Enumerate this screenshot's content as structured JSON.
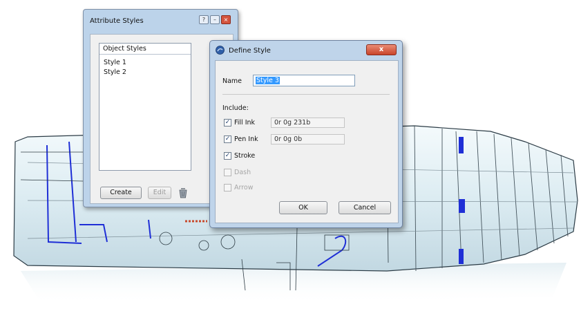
{
  "attribute_styles_window": {
    "title": "Attribute Styles",
    "list_header": "Object Styles",
    "items": [
      "Style 1",
      "Style 2"
    ],
    "create_label": "Create",
    "edit_label": "Edit"
  },
  "define_style_dialog": {
    "title": "Define Style",
    "close_glyph": "x",
    "name_label": "Name",
    "name_value": "Style 3",
    "include_label": "Include:",
    "options": [
      {
        "label": "Fill Ink",
        "checked": true,
        "enabled": true,
        "value": "0r 0g 231b"
      },
      {
        "label": "Pen Ink",
        "checked": true,
        "enabled": true,
        "value": "0r 0g 0b"
      },
      {
        "label": "Stroke",
        "checked": true,
        "enabled": true
      },
      {
        "label": "Dash",
        "checked": false,
        "enabled": false
      },
      {
        "label": "Arrow",
        "checked": false,
        "enabled": false
      }
    ],
    "ok_label": "OK",
    "cancel_label": "Cancel"
  },
  "colors": {
    "window_frame": "#bfd4ea",
    "selection": "#3399ff",
    "model_highlight": "#1f2fd6",
    "model_fill": "#dfeff4"
  }
}
